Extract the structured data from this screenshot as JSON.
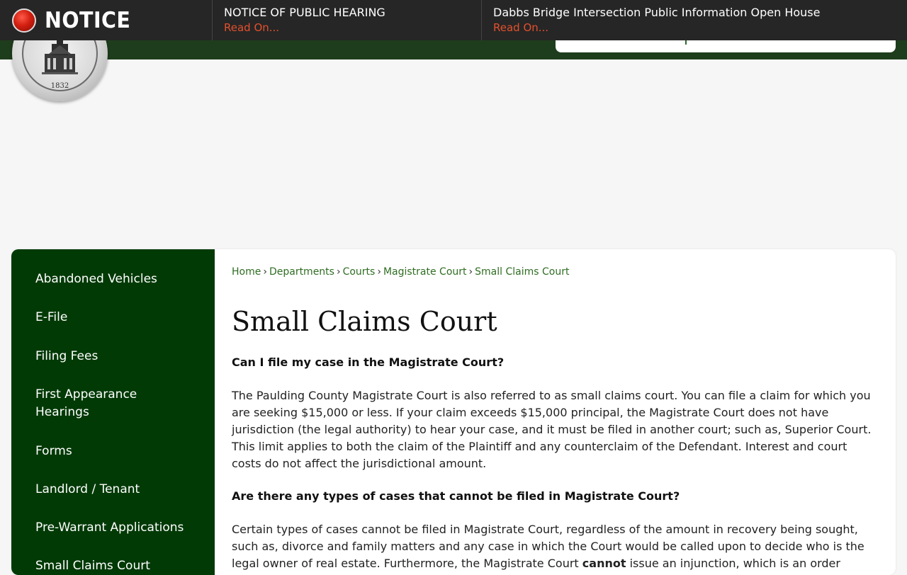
{
  "notice": {
    "label": "NOTICE",
    "items": [
      {
        "title": "NOTICE OF PUBLIC HEARING",
        "link": "Read On..."
      },
      {
        "title": "Dabbs Bridge Intersection Public Information Open House",
        "link": "Read On..."
      }
    ]
  },
  "seal": {
    "year": "1832"
  },
  "sidebar": {
    "items": [
      {
        "label": "Abandoned Vehicles"
      },
      {
        "label": "E-File"
      },
      {
        "label": "Filing Fees"
      },
      {
        "label": "First Appearance Hearings"
      },
      {
        "label": "Forms"
      },
      {
        "label": "Landlord / Tenant"
      },
      {
        "label": "Pre-Warrant Applications"
      },
      {
        "label": "Small Claims Court"
      }
    ]
  },
  "breadcrumb": {
    "items": [
      "Home",
      "Departments",
      "Courts",
      "Magistrate Court",
      "Small Claims Court"
    ],
    "separator": "›"
  },
  "page": {
    "title": "Small Claims Court",
    "q1": "Can I file my case in the Magistrate Court?",
    "p1": "The Paulding County Magistrate Court is also referred to as small claims court. You can file a claim for which you are seeking $15,000 or less. If your claim exceeds $15,000 principal, the Magistrate Court does not have jurisdiction (the legal authority) to hear your case, and it must be filed in another court; such as, Superior Court. This limit applies to both the claim of the Plaintiff and any counterclaim of the Defendant. Interest and court costs do not affect the jurisdictional amount.",
    "q2": "Are there any types of cases that cannot be filed in Magistrate Court?",
    "p2_a": "Certain types of cases cannot be filed in Magistrate Court, regardless of the amount in recovery being sought, such as, divorce and family matters and any case in which the Court would be called upon to decide who is the legal owner of real estate. Furthermore, the Magistrate Court ",
    "p2_bold": "cannot",
    "p2_b": " issue an injunction, which is an order directing a party to take some"
  },
  "colors": {
    "notice_bg": "#262626",
    "notice_link": "#e4502c",
    "sidebar_bg": "#023a06",
    "breadcrumb_link": "#2f6d22",
    "header_strip": "#1e3d1c"
  }
}
